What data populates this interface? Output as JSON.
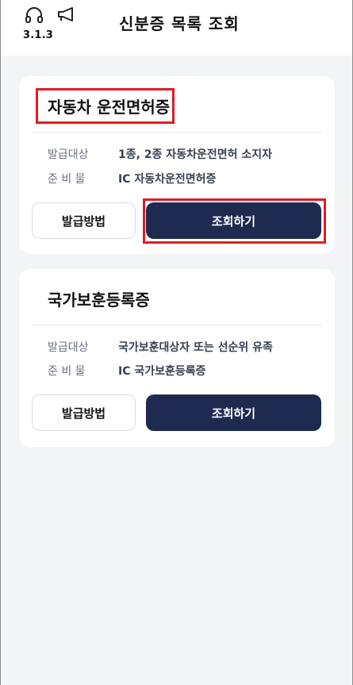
{
  "header": {
    "version": "3.1.3",
    "title": "신분증 목록 조회",
    "icons": [
      "headset-icon",
      "megaphone-icon"
    ]
  },
  "cards": [
    {
      "title": "자동차 운전면허증",
      "rows": [
        {
          "label": "발급대상",
          "value": "1종, 2종 자동차운전면허 소지자"
        },
        {
          "label": "준 비 물",
          "value": "IC 자동차운전면허증"
        }
      ],
      "issue_button": "발급방법",
      "view_button": "조회하기"
    },
    {
      "title": "국가보훈등록증",
      "rows": [
        {
          "label": "발급대상",
          "value": "국가보훈대상자 또는 선순위 유족"
        },
        {
          "label": "준 비 물",
          "value": "IC 국가보훈등록증"
        }
      ],
      "issue_button": "발급방법",
      "view_button": "조회하기"
    }
  ],
  "colors": {
    "primary": "#1e2a50",
    "highlight": "#e01c24",
    "background": "#f3f4f6"
  }
}
